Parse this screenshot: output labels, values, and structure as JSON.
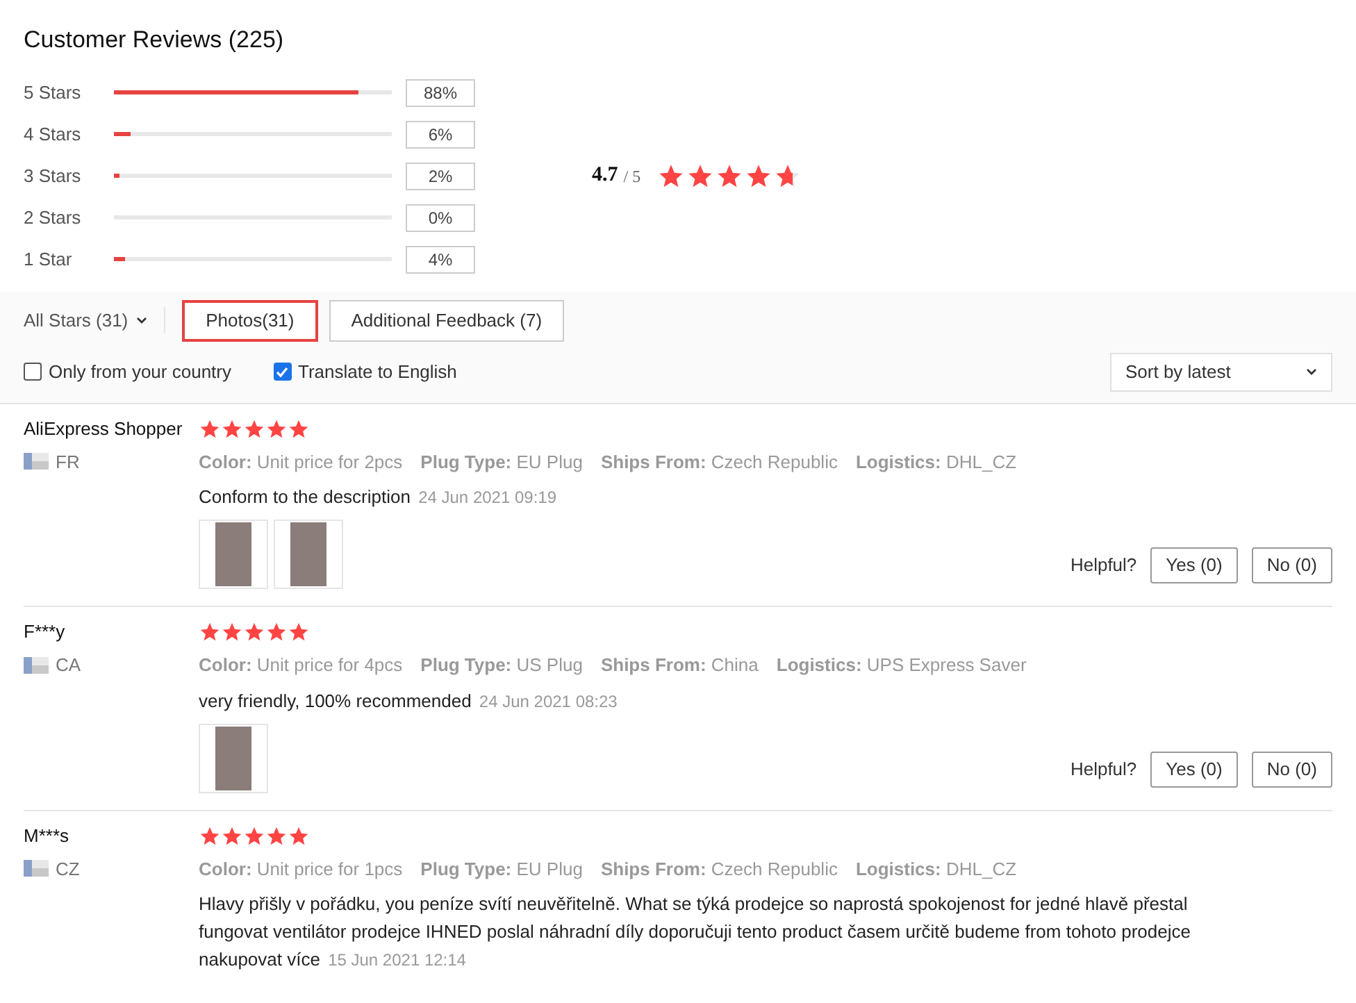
{
  "title": "Customer Reviews (225)",
  "breakdown": [
    {
      "label": "5 Stars",
      "level": 0.88,
      "percent": "88%"
    },
    {
      "label": "4 Stars",
      "level": 0.06,
      "percent": "6%"
    },
    {
      "label": "3 Stars",
      "level": 0.02,
      "percent": "2%"
    },
    {
      "label": "2 Stars",
      "level": 0,
      "percent": "0%"
    },
    {
      "label": "1 Star",
      "level": 0.04,
      "percent": "4%"
    }
  ],
  "overall": {
    "score": "4.7",
    "out_of": "/ 5",
    "stars": 4.7
  },
  "filters": {
    "dropdown": "All Stars (31)",
    "tabs": [
      {
        "label": "Photos(31)",
        "selected": true
      },
      {
        "label": "Additional Feedback (7)",
        "selected": false
      }
    ]
  },
  "options": [
    {
      "label": "Only from your country",
      "checked": false
    },
    {
      "label": "Translate to English",
      "checked": true
    }
  ],
  "sort": {
    "value": "Sort by latest"
  },
  "reviews": [
    {
      "author": "AliExpress Shopper",
      "country": "FR",
      "stars": 5,
      "attributes": [
        {
          "label": "Color:",
          "value": "Unit price for 2pcs"
        },
        {
          "label": "Plug Type:",
          "value": "EU Plug"
        },
        {
          "label": "Ships From:",
          "value": "Czech Republic"
        },
        {
          "label": "Logistics:",
          "value": "DHL_CZ"
        }
      ],
      "text": "Conform to the description",
      "date": "24 Jun 2021 09:19",
      "photos": [
        {
          "kind": "photo"
        },
        {
          "kind": "photo"
        }
      ],
      "helpful": {
        "label": "Helpful?",
        "yes": "Yes (0)",
        "no": "No (0)"
      }
    },
    {
      "author": "F***y",
      "country": "CA",
      "stars": 5,
      "attributes": [
        {
          "label": "Color:",
          "value": "Unit price for 4pcs"
        },
        {
          "label": "Plug Type:",
          "value": "US Plug"
        },
        {
          "label": "Ships From:",
          "value": "China"
        },
        {
          "label": "Logistics:",
          "value": "UPS Express Saver"
        }
      ],
      "text": "very friendly, 100% recommended",
      "date": "24 Jun 2021 08:23",
      "photos": [
        {
          "kind": "photo"
        }
      ],
      "helpful": {
        "label": "Helpful?",
        "yes": "Yes (0)",
        "no": "No (0)"
      }
    },
    {
      "author": "M***s",
      "country": "CZ",
      "stars": 5,
      "attributes": [
        {
          "label": "Color:",
          "value": "Unit price for 1pcs"
        },
        {
          "label": "Plug Type:",
          "value": "EU Plug"
        },
        {
          "label": "Ships From:",
          "value": "Czech Republic"
        },
        {
          "label": "Logistics:",
          "value": "DHL_CZ"
        }
      ],
      "text": "Hlavy přišly v pořádku, you peníze svítí neuvěřitelně. What se týká prodejce so naprostá spokojenost for jedné hlavě přestal fungovat ventilátor prodejce IHNED poslal náhradní díly doporučuji tento product časem určitě budeme from tohoto prodejce nakupovat více",
      "date": "15 Jun 2021 12:14"
    }
  ]
}
